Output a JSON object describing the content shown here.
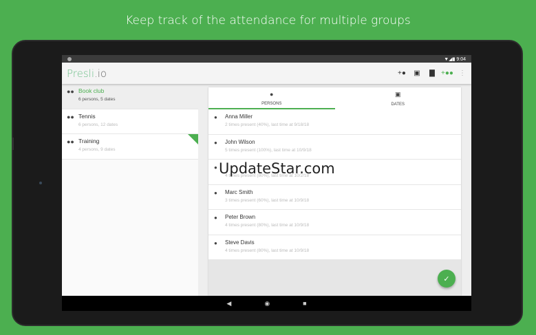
{
  "headline": "Keep track of the attendance for multiple groups",
  "status": {
    "time": "9:04"
  },
  "app": {
    "logo_main": "Presli",
    "logo_suffix": ".io"
  },
  "groups": [
    {
      "name": "Book club",
      "summary": "6 persons, 5 dates"
    },
    {
      "name": "Tennis",
      "summary": "6 persons, 12 dates"
    },
    {
      "name": "Training",
      "summary": "4 persons, 9 dates"
    }
  ],
  "tabs": {
    "persons": "PERSONS",
    "dates": "DATES"
  },
  "persons": [
    {
      "name": "Anna Miller",
      "summary": "2 times present (40%), last time at 9/18/18"
    },
    {
      "name": "John Wilson",
      "summary": "5 times present (100%), last time at 10/9/18"
    },
    {
      "name": "",
      "summary": "4 times present (80%), last time at 10/2/18"
    },
    {
      "name": "Marc Smith",
      "summary": "3 times present (60%), last time at 10/9/18"
    },
    {
      "name": "Peter Brown",
      "summary": "4 times present (80%), last time at 10/9/18"
    },
    {
      "name": "Steve Davis",
      "summary": "4 times present (80%), last time at 10/9/18"
    }
  ],
  "watermark": "UpdateStar.com",
  "colors": {
    "accent": "#4caf50"
  }
}
